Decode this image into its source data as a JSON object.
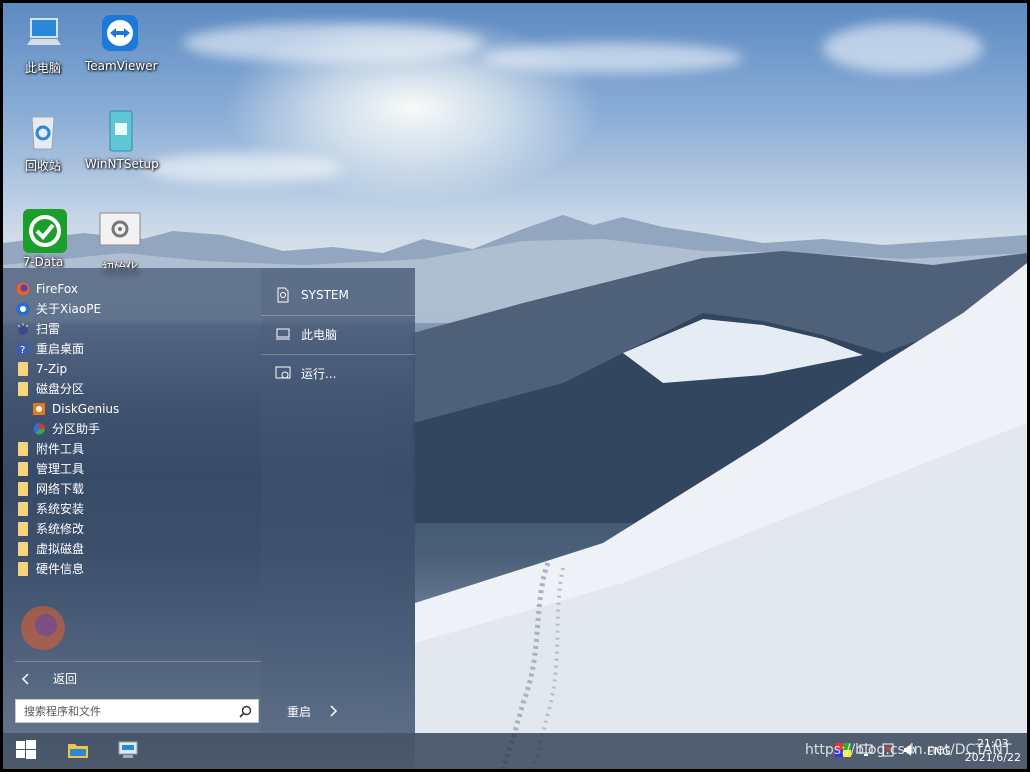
{
  "desktop": {
    "icons": [
      {
        "label": "此电脑",
        "icon": "computer-icon"
      },
      {
        "label": "TeamViewer",
        "icon": "teamviewer-icon"
      },
      {
        "label": "回收站",
        "icon": "recycle-bin-icon"
      },
      {
        "label": "WinNTSetup",
        "icon": "winntsetup-icon"
      },
      {
        "label": "7-Data",
        "icon": "7-data-icon"
      },
      {
        "label": "初始化",
        "icon": "settings-gear-icon"
      }
    ]
  },
  "start_menu": {
    "apps": [
      {
        "label": "FireFox",
        "icon": "firefox-icon"
      },
      {
        "label": "关于XiaoPE",
        "icon": "about-icon"
      },
      {
        "label": "扫雷",
        "icon": "minesweeper-icon"
      },
      {
        "label": "重启桌面",
        "icon": "help-icon"
      },
      {
        "label": "7-Zip",
        "icon": "folder-icon"
      },
      {
        "label": "磁盘分区",
        "icon": "folder-icon"
      },
      {
        "label": "DiskGenius",
        "icon": "diskgenius-icon"
      },
      {
        "label": "分区助手",
        "icon": "partition-assistant-icon"
      },
      {
        "label": "附件工具",
        "icon": "folder-icon"
      },
      {
        "label": "管理工具",
        "icon": "folder-icon"
      },
      {
        "label": "网络下载",
        "icon": "folder-icon"
      },
      {
        "label": "系统安装",
        "icon": "folder-icon"
      },
      {
        "label": "系统修改",
        "icon": "folder-icon"
      },
      {
        "label": "虚拟磁盘",
        "icon": "folder-icon"
      },
      {
        "label": "硬件信息",
        "icon": "folder-icon"
      }
    ],
    "back_label": "返回",
    "search_placeholder": "搜索程序和文件",
    "restart_label": "重启",
    "right": [
      {
        "label": "SYSTEM",
        "icon": "user-icon"
      },
      {
        "label": "此电脑",
        "icon": "computer-icon"
      },
      {
        "label": "运行...",
        "icon": "run-icon"
      }
    ]
  },
  "taskbar": {
    "tray_lang": "ENG",
    "time": "21:03",
    "date": "2021/6/22"
  },
  "watermark": "https://blog.csdn.net/DCTANT",
  "colors": {
    "folder": "#f6d47b",
    "taskbar": "#28374b",
    "start_menu": "#344664"
  }
}
